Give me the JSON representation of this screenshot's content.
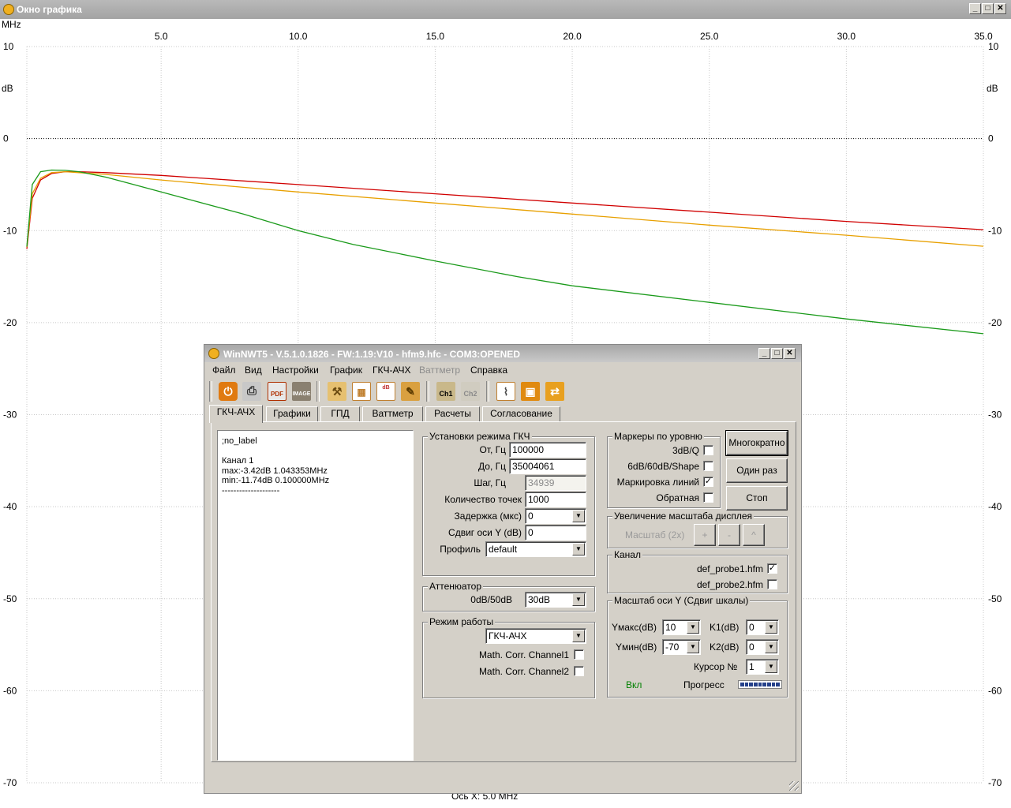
{
  "graph_window": {
    "title": "Окно графика",
    "x_unit": "MHz",
    "y_unit": "dB",
    "axis_status": "Ось X: 5.0 MHz",
    "buttons": {
      "minimize": "_",
      "maximize": "□",
      "close": "✕"
    }
  },
  "chart_data": {
    "type": "line",
    "xlim": [
      0.1,
      35.0
    ],
    "ylim": [
      -70,
      10
    ],
    "x_ticks": [
      5.0,
      10.0,
      15.0,
      20.0,
      25.0,
      30.0,
      35.0
    ],
    "y_ticks": [
      10,
      0,
      -10,
      -20,
      -30,
      -40,
      -50,
      -60,
      -70
    ],
    "xlabel": "MHz",
    "ylabel": "dB",
    "grid": true,
    "reference_line_y": 0,
    "series": [
      {
        "color": "#d00000",
        "x": [
          0.1,
          0.3,
          0.6,
          1.0,
          1.5,
          2.0,
          3.0,
          5.0,
          8.0,
          10.0,
          15.0,
          20.0,
          25.0,
          30.0,
          35.0
        ],
        "y": [
          -12.0,
          -6.5,
          -4.5,
          -3.8,
          -3.6,
          -3.6,
          -3.7,
          -4.0,
          -4.6,
          -5.0,
          -6.0,
          -7.0,
          -8.0,
          -9.0,
          -9.9
        ]
      },
      {
        "color": "#e8a000",
        "x": [
          0.1,
          0.3,
          0.6,
          1.0,
          1.5,
          2.0,
          3.0,
          5.0,
          8.0,
          10.0,
          15.0,
          20.0,
          25.0,
          30.0,
          35.0
        ],
        "y": [
          -11.8,
          -6.0,
          -4.3,
          -3.7,
          -3.6,
          -3.7,
          -3.9,
          -4.5,
          -5.3,
          -5.8,
          -7.0,
          -8.2,
          -9.4,
          -10.5,
          -11.7
        ]
      },
      {
        "color": "#1a9a1a",
        "x": [
          0.1,
          0.3,
          0.6,
          1.0,
          1.5,
          2.0,
          3.0,
          4.0,
          5.0,
          6.0,
          8.0,
          10.0,
          12.0,
          15.0,
          18.0,
          20.0,
          25.0,
          30.0,
          35.0
        ],
        "y": [
          -11.74,
          -5.0,
          -3.6,
          -3.42,
          -3.45,
          -3.6,
          -4.2,
          -5.0,
          -5.8,
          -6.6,
          -8.2,
          -10.0,
          -11.5,
          -13.3,
          -15.0,
          -16.0,
          -17.8,
          -19.6,
          -21.2
        ]
      }
    ]
  },
  "dialog": {
    "title": "WinNWT5 - V.5.1.0.1826 - FW:1.19:V10 - hfm9.hfc - COM3:OPENED",
    "buttons": {
      "minimize": "_",
      "maximize": "□",
      "close": "✕"
    },
    "menu": [
      {
        "label": "Файл",
        "enabled": true
      },
      {
        "label": "Вид",
        "enabled": true
      },
      {
        "label": "Настройки",
        "enabled": true
      },
      {
        "label": "График",
        "enabled": true
      },
      {
        "label": "ГКЧ-АЧХ",
        "enabled": true
      },
      {
        "label": "Ваттметр",
        "enabled": false
      },
      {
        "label": "Справка",
        "enabled": true
      }
    ],
    "toolbar": {
      "pdf": "PDF",
      "image": "IMAGE",
      "db": "dB",
      "ch1": "Ch1",
      "ch2": "Ch2"
    },
    "tabs": [
      "ГКЧ-АЧХ",
      "Графики",
      "ГПД",
      "Ваттметр",
      "Расчеты",
      "Согласование"
    ],
    "active_tab": "ГКЧ-АЧХ",
    "memo": ";no_label\n\nКанал 1\nmax:-3.42dB 1.043353MHz\nmin:-11.74dB 0.100000MHz\n--------------------",
    "sweep_settings": {
      "legend": "Установки режима ГКЧ",
      "from_label": "От, Гц",
      "from_value": "100000",
      "to_label": "До, Гц",
      "to_value": "35004061",
      "step_label": "Шаг, Гц",
      "step_value": "34939",
      "points_label": "Количество точек",
      "points_value": "1000",
      "delay_label": "Задержка (мкс)",
      "delay_value": "0",
      "yshift_label": "Сдвиг оси Y (dB)",
      "yshift_value": "0",
      "profile_label": "Профиль",
      "profile_value": "default"
    },
    "attenuator": {
      "legend": "Аттенюатор",
      "label": "0dB/50dB",
      "value": "30dB"
    },
    "mode": {
      "legend": "Режим работы",
      "value": "ГКЧ-АЧХ",
      "corr1_label": "Math. Corr. Channel1",
      "corr1_checked": false,
      "corr2_label": "Math. Corr. Channel2",
      "corr2_checked": false
    },
    "level_markers": {
      "legend": "Маркеры по уровню",
      "q3db_label": "3dB/Q",
      "q3db_checked": false,
      "shape_label": "6dB/60dB/Shape",
      "shape_checked": false,
      "line_marking_label": "Маркировка линий",
      "line_marking_checked": true,
      "inverse_label": "Обратная",
      "inverse_checked": false
    },
    "run_buttons": {
      "repeat": "Многократно",
      "once": "Один раз",
      "stop": "Стоп"
    },
    "zoom": {
      "legend": "Увеличение масштаба дисплея",
      "label": "Масштаб (2х)",
      "plus": "+",
      "minus": "-",
      "up": "^"
    },
    "channel": {
      "legend": "Канал",
      "probe1_label": "def_probe1.hfm",
      "probe1_checked": true,
      "probe2_label": "def_probe2.hfm",
      "probe2_checked": false
    },
    "y_scale": {
      "legend": "Масштаб оси Y (Сдвиг шкалы)",
      "ymax_label": "Yмакс(dB)",
      "ymax_value": "10",
      "ymin_label": "Yмин(dB)",
      "ymin_value": "-70",
      "k1_label": "K1(dB)",
      "k1_value": "0",
      "k2_label": "K2(dB)",
      "k2_value": "0",
      "cursor_label": "Курсор №",
      "cursor_value": "1",
      "on_label": "Вкл",
      "on_color": "#008000",
      "progress_label": "Прогресс",
      "progress": 1.0
    }
  }
}
